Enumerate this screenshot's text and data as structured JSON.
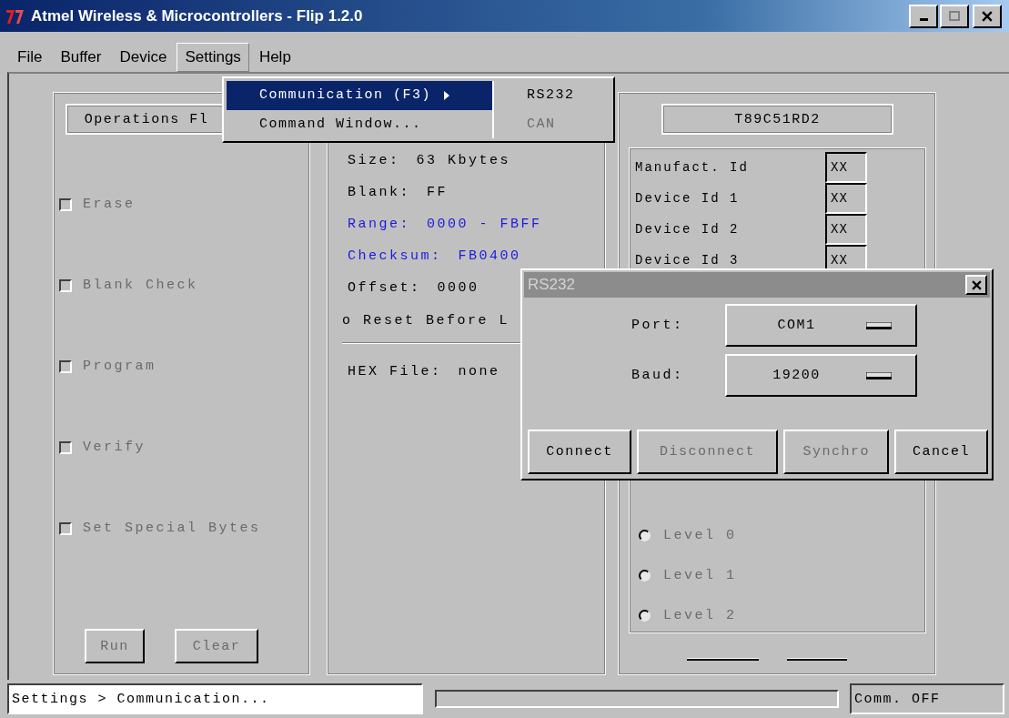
{
  "window": {
    "title": "Atmel Wireless & Microcontrollers - Flip 1.2.0"
  },
  "menu_bar": [
    {
      "label": "File",
      "selected": false
    },
    {
      "label": "Buffer",
      "selected": false
    },
    {
      "label": "Device",
      "selected": false
    },
    {
      "label": "Settings",
      "selected": true
    },
    {
      "label": "Help",
      "selected": false
    }
  ],
  "settings_menu": {
    "items": [
      {
        "label": "Communication (F3)",
        "selected": true,
        "submenu": true
      },
      {
        "label": "Command Window...",
        "selected": false,
        "submenu": false
      }
    ],
    "submenu": [
      {
        "label": "RS232",
        "disabled": false
      },
      {
        "label": "CAN",
        "disabled": true
      }
    ]
  },
  "operations": {
    "title": "Operations Fl",
    "steps": [
      {
        "label": "Erase",
        "checked": false,
        "disabled": true
      },
      {
        "label": "Blank Check",
        "checked": false,
        "disabled": true
      },
      {
        "label": "Program",
        "checked": false,
        "disabled": true
      },
      {
        "label": "Verify",
        "checked": false,
        "disabled": true
      },
      {
        "label": "Set Special Bytes",
        "checked": false,
        "disabled": true
      }
    ],
    "buttons": [
      {
        "label": "Run",
        "disabled": true
      },
      {
        "label": "Clear",
        "disabled": true
      }
    ]
  },
  "buffer": {
    "lines": [
      {
        "label": "Size:",
        "value": "63 Kbytes",
        "highlight": false
      },
      {
        "label": "Blank:",
        "value": "FF",
        "highlight": false
      },
      {
        "label": "Range:",
        "value": "0000 - FBFF",
        "highlight": true
      },
      {
        "label": "Checksum:",
        "value": "FB0400",
        "highlight": true
      },
      {
        "label": "Offset:",
        "value": "0000",
        "highlight": false
      }
    ],
    "reset": "o Reset Before L",
    "hex_file": {
      "label": "HEX File:",
      "value": "none"
    }
  },
  "device": {
    "name": "T89C51RD2",
    "ids": [
      {
        "label": "Manufact. Id",
        "value": "XX"
      },
      {
        "label": "Device Id 1",
        "value": "XX"
      },
      {
        "label": "Device Id 2",
        "value": "XX"
      },
      {
        "label": "Device Id 3",
        "value": "XX"
      }
    ],
    "levels": [
      {
        "label": "Level 0",
        "selected": false,
        "disabled": true
      },
      {
        "label": "Level 1",
        "selected": false,
        "disabled": true
      },
      {
        "label": "Level 2",
        "selected": false,
        "disabled": true
      }
    ]
  },
  "dialog": {
    "title": "RS232",
    "active": false,
    "fields": [
      {
        "label": "Port:",
        "value": "COM1"
      },
      {
        "label": "Baud:",
        "value": "19200"
      }
    ],
    "buttons": [
      {
        "label": "Connect",
        "disabled": false
      },
      {
        "label": "Disconnect",
        "disabled": true
      },
      {
        "label": "Synchro",
        "disabled": true
      },
      {
        "label": "Cancel",
        "disabled": false
      }
    ]
  },
  "status_bar": {
    "message": "Settings > Communication...",
    "progress": {
      "level": 0
    },
    "connection": "Comm. OFF"
  }
}
